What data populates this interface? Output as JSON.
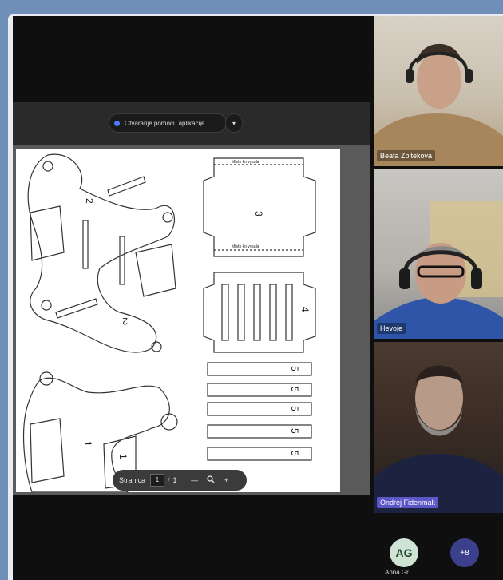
{
  "share": {
    "banner_label": "Otvaranje pomocu aplikacije...",
    "caret_icon": "chevron-down-icon"
  },
  "document": {
    "top_label_a": "Místo ko vysala",
    "top_label_b": "Místo ko vysala",
    "part_numbers": [
      "2",
      "2",
      "3",
      "4",
      "5",
      "5",
      "5",
      "5",
      "5",
      "1",
      "1"
    ]
  },
  "pdf_toolbar": {
    "page_label": "Stranica",
    "current_page": "1",
    "separator": "/",
    "total_pages": "1",
    "zoom_out": "—",
    "zoom_icon": "magnifier-icon",
    "zoom_in": "+"
  },
  "participants": [
    {
      "name": "Beata Zbitekova"
    },
    {
      "name": "Hevoje"
    },
    {
      "name": "Ondrej Fidenmak"
    }
  ],
  "avatars": {
    "initials": "AG",
    "name": "Anna Gr...",
    "more": "+8"
  }
}
